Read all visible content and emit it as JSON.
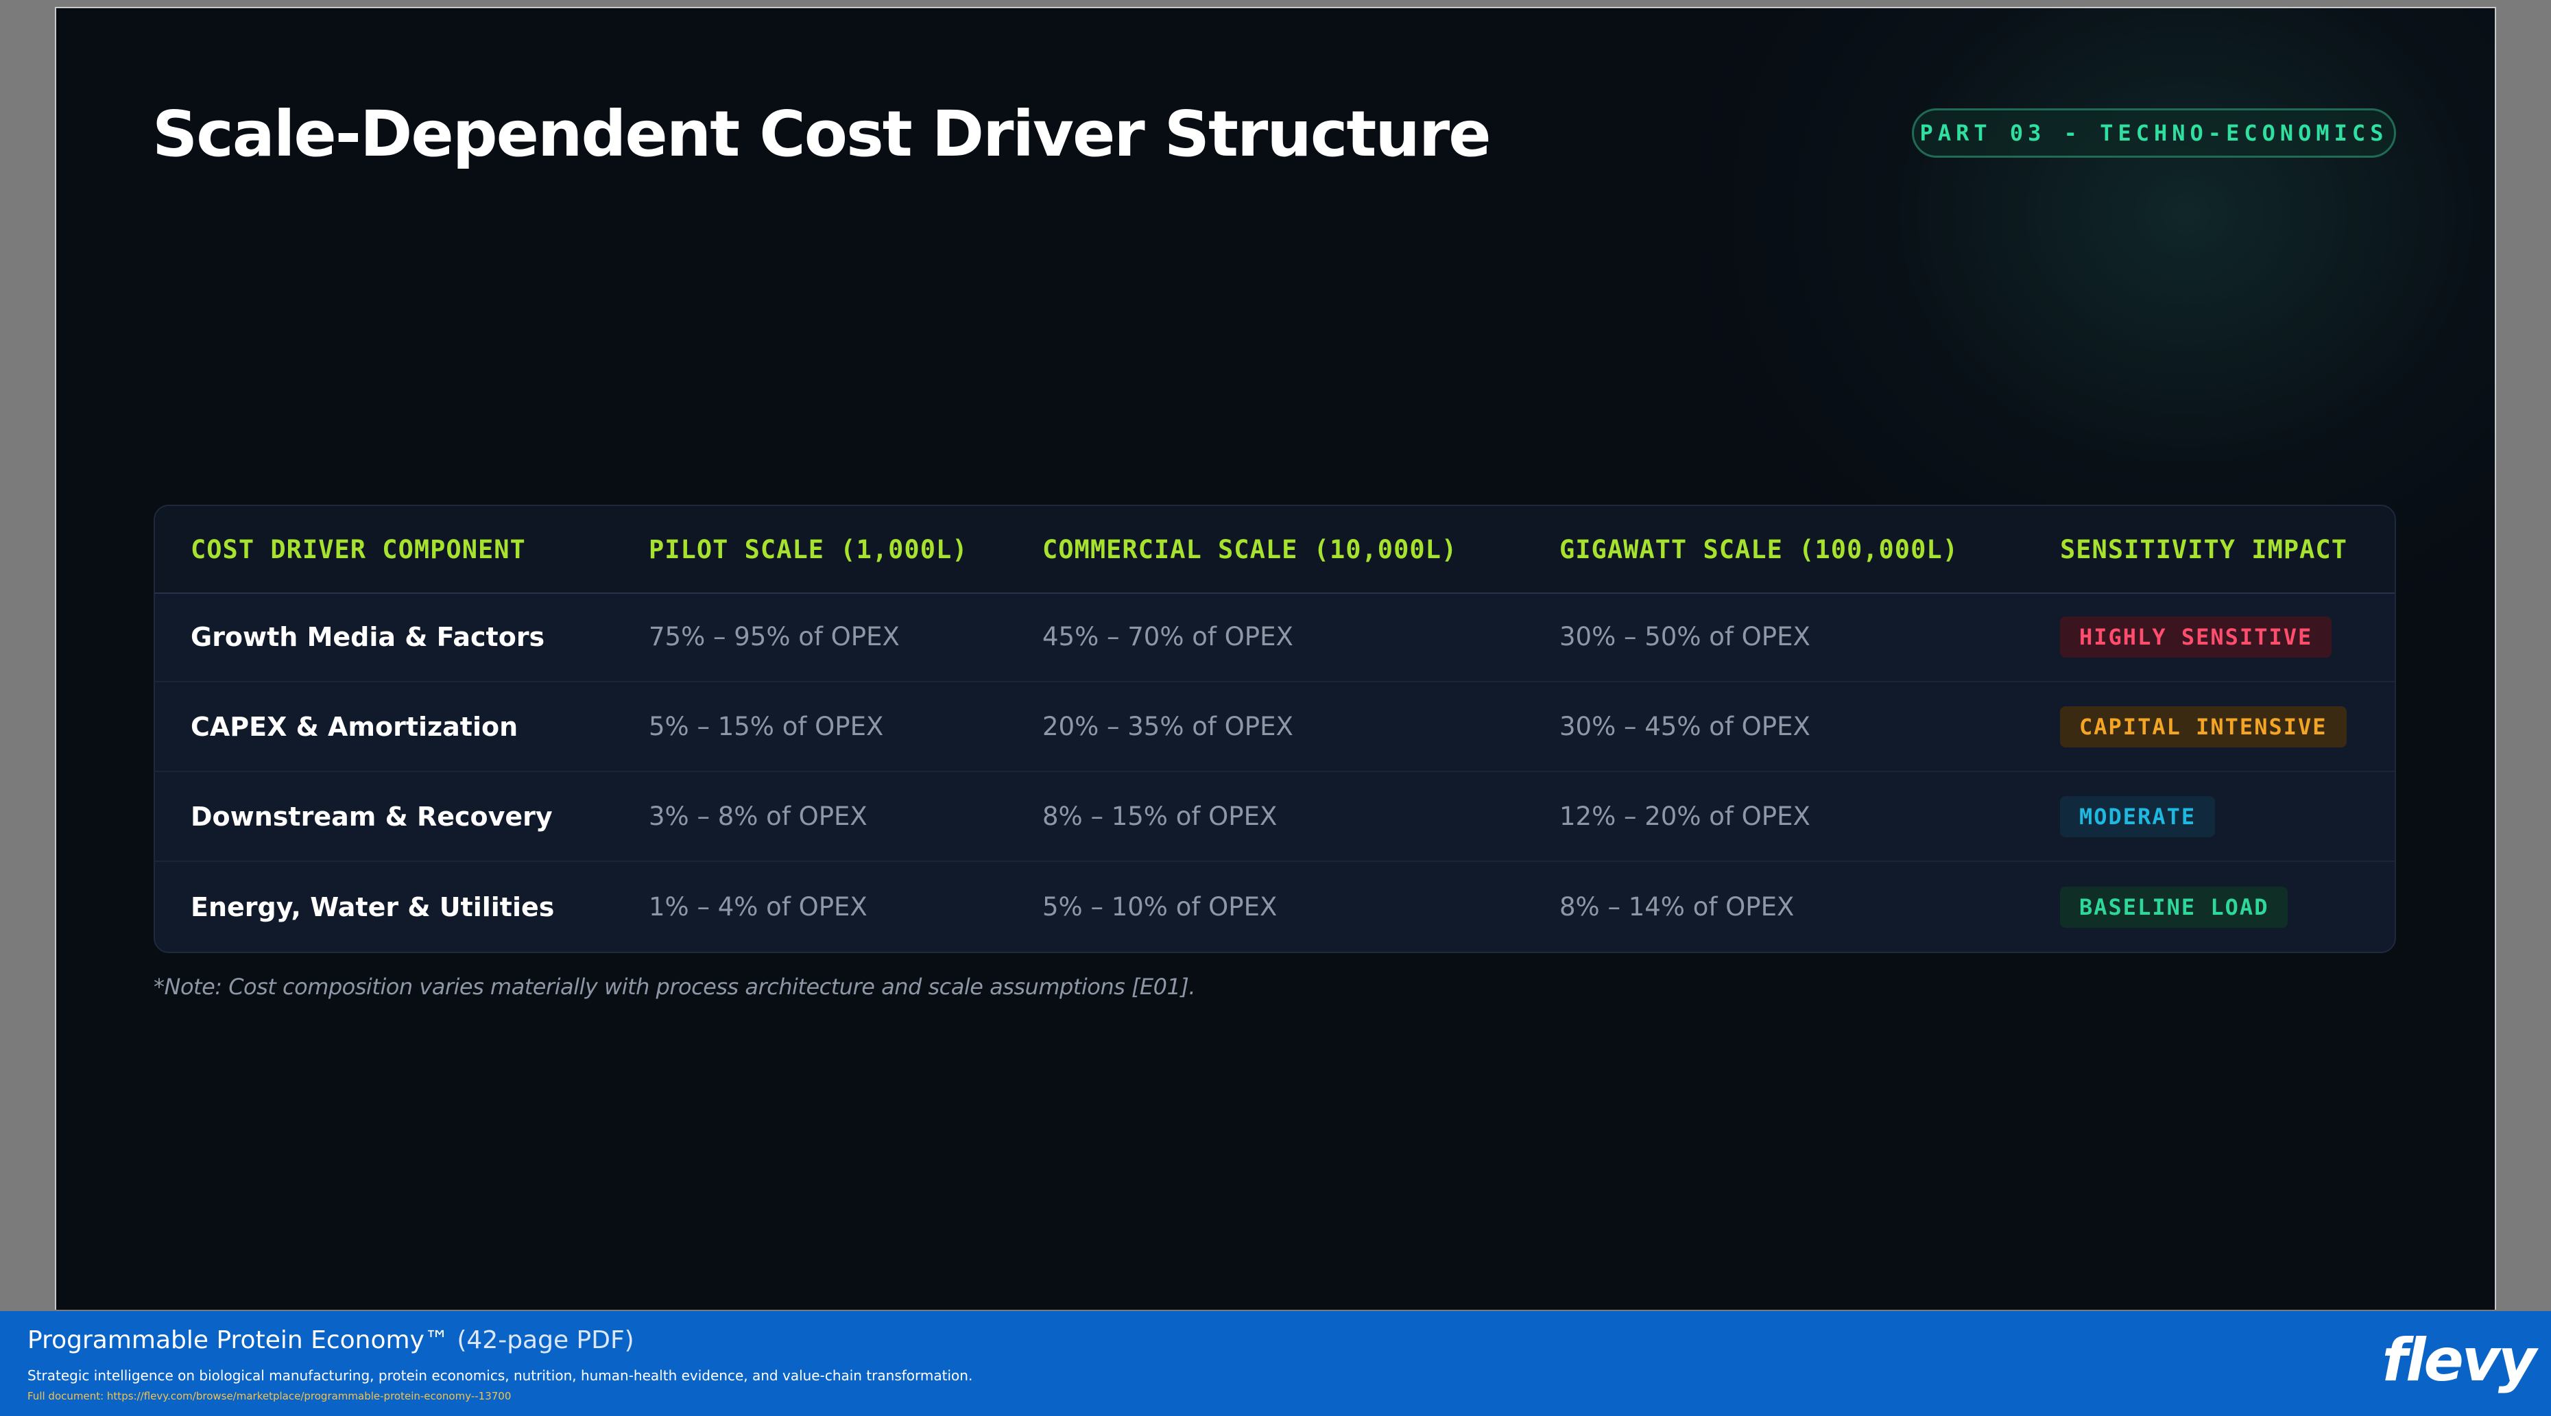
{
  "slide": {
    "title": "Scale-Dependent Cost Driver Structure",
    "tag": "PART 03 - TECHNO-ECONOMICS"
  },
  "table": {
    "headers": [
      "COST DRIVER COMPONENT",
      "PILOT SCALE (1,000L)",
      "COMMERCIAL SCALE (10,000L)",
      "GIGAWATT SCALE (100,000L)",
      "SENSITIVITY IMPACT"
    ],
    "rows": [
      {
        "component": "Growth Media & Factors",
        "pilot": "75% – 95% of OPEX",
        "commercial": "45% – 70% of OPEX",
        "gigawatt": "30% – 50% of OPEX",
        "impact": "HIGHLY SENSITIVE",
        "impact_color": "#ff4d6d"
      },
      {
        "component": "CAPEX & Amortization",
        "pilot": "5% – 15% of OPEX",
        "commercial": "20% – 35% of OPEX",
        "gigawatt": "30% – 45% of OPEX",
        "impact": "CAPITAL INTENSIVE",
        "impact_color": "#f5a524"
      },
      {
        "component": "Downstream & Recovery",
        "pilot": "3% – 8% of OPEX",
        "commercial": "8% – 15% of OPEX",
        "gigawatt": "12% – 20% of OPEX",
        "impact": "MODERATE",
        "impact_color": "#1fb8e0"
      },
      {
        "component": "Energy, Water & Utilities",
        "pilot": "1% – 4% of OPEX",
        "commercial": "5% – 10% of OPEX",
        "gigawatt": "8% – 14% of OPEX",
        "impact": "BASELINE LOAD",
        "impact_color": "#2ed89a"
      }
    ]
  },
  "note": "*Note: Cost composition varies materially with process architecture and scale assumptions [E01].",
  "footer": {
    "title": "Programmable Protein Economy™",
    "title_suffix": "(42-page PDF)",
    "subtitle": "Strategic intelligence on biological manufacturing, protein economics, nutrition, human-health evidence, and value-chain transformation.",
    "link": "Full document: https://flevy.com/browse/marketplace/programmable-protein-economy--13700",
    "logo": "flevy"
  }
}
